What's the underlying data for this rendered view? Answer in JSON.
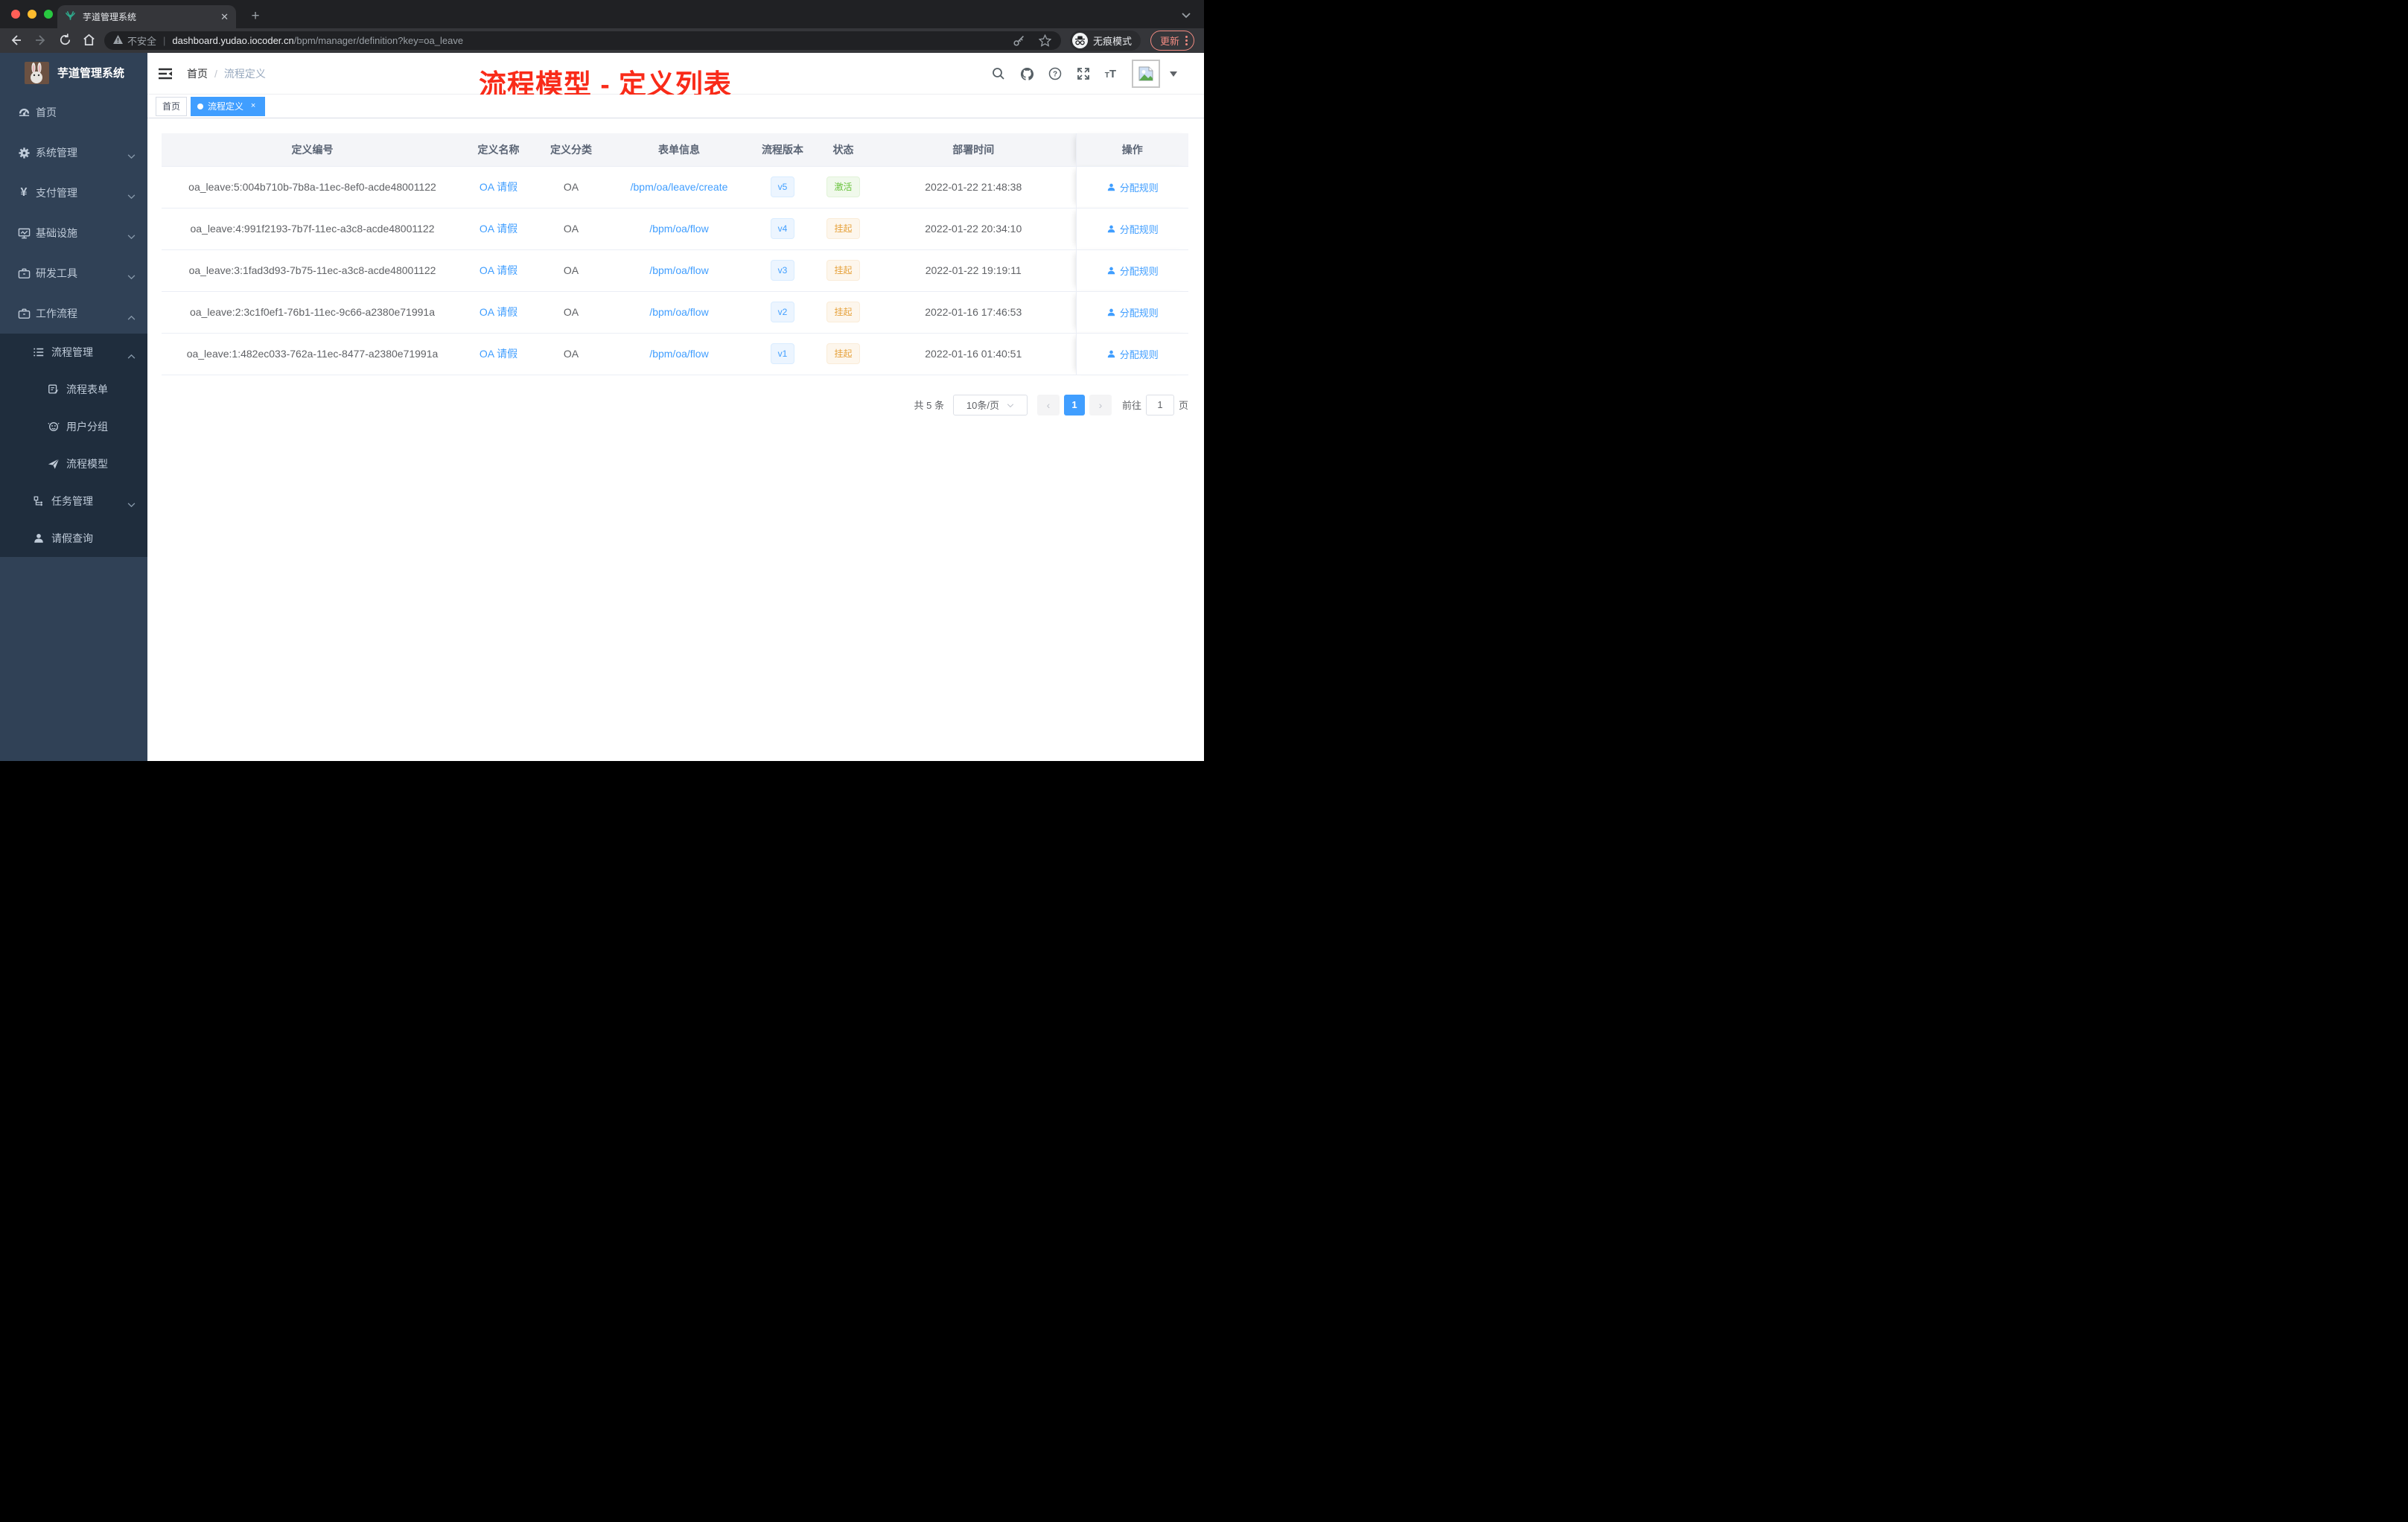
{
  "colors": {
    "accent": "#409eff",
    "success": "#67c23a",
    "warning": "#e6a23c",
    "annotation_red": "#f92b19",
    "sidebar_bg": "#304156",
    "submenu_bg": "#1f2d3d"
  },
  "browser": {
    "tab_title": "芋道管理系统",
    "new_tab_label": "+",
    "security_label": "不安全",
    "url_host": "dashboard.yudao.iocoder.cn",
    "url_path": "/bpm/manager/definition?key=oa_leave",
    "incognito_label": "无痕模式",
    "update_label": "更新"
  },
  "sidebar": {
    "brand": "芋道管理系统",
    "items": [
      {
        "label": "首页",
        "icon": "dashboard-icon"
      },
      {
        "label": "系统管理",
        "icon": "gear-icon"
      },
      {
        "label": "支付管理",
        "icon": "yen-icon"
      },
      {
        "label": "基础设施",
        "icon": "monitor-icon"
      },
      {
        "label": "研发工具",
        "icon": "toolbox-icon"
      },
      {
        "label": "工作流程",
        "icon": "workflow-icon"
      },
      {
        "label": "流程管理",
        "icon": "process-list-icon"
      },
      {
        "label": "流程表单",
        "icon": "form-icon"
      },
      {
        "label": "用户分组",
        "icon": "user-group-icon"
      },
      {
        "label": "流程模型",
        "icon": "paper-plane-icon"
      },
      {
        "label": "任务管理",
        "icon": "task-tree-icon"
      },
      {
        "label": "请假查询",
        "icon": "person-icon"
      }
    ]
  },
  "header": {
    "breadcrumb_home": "首页",
    "breadcrumb_sep": "/",
    "breadcrumb_current": "流程定义",
    "annotation": "流程模型 - 定义列表"
  },
  "tags": {
    "items": [
      {
        "label": "首页"
      },
      {
        "label": "流程定义",
        "close": "×"
      }
    ]
  },
  "table": {
    "columns": [
      "定义编号",
      "定义名称",
      "定义分类",
      "表单信息",
      "流程版本",
      "状态",
      "部署时间",
      "操作"
    ],
    "rows": [
      {
        "id": "oa_leave:5:004b710b-7b8a-11ec-8ef0-acde48001122",
        "name": "OA 请假",
        "category": "OA",
        "form": "/bpm/oa/leave/create",
        "version": "v5",
        "status": "激活",
        "status_type": "success",
        "deployed_at": "2022-01-22 21:48:38",
        "action": "分配规则"
      },
      {
        "id": "oa_leave:4:991f2193-7b7f-11ec-a3c8-acde48001122",
        "name": "OA 请假",
        "category": "OA",
        "form": "/bpm/oa/flow",
        "version": "v4",
        "status": "挂起",
        "status_type": "warning",
        "deployed_at": "2022-01-22 20:34:10",
        "action": "分配规则"
      },
      {
        "id": "oa_leave:3:1fad3d93-7b75-11ec-a3c8-acde48001122",
        "name": "OA 请假",
        "category": "OA",
        "form": "/bpm/oa/flow",
        "version": "v3",
        "status": "挂起",
        "status_type": "warning",
        "deployed_at": "2022-01-22 19:19:11",
        "action": "分配规则"
      },
      {
        "id": "oa_leave:2:3c1f0ef1-76b1-11ec-9c66-a2380e71991a",
        "name": "OA 请假",
        "category": "OA",
        "form": "/bpm/oa/flow",
        "version": "v2",
        "status": "挂起",
        "status_type": "warning",
        "deployed_at": "2022-01-16 17:46:53",
        "action": "分配规则"
      },
      {
        "id": "oa_leave:1:482ec033-762a-11ec-8477-a2380e71991a",
        "name": "OA 请假",
        "category": "OA",
        "form": "/bpm/oa/flow",
        "version": "v1",
        "status": "挂起",
        "status_type": "warning",
        "deployed_at": "2022-01-16 01:40:51",
        "action": "分配规则"
      }
    ]
  },
  "pagination": {
    "total": "共 5 条",
    "page_size": "10条/页",
    "prev": "‹",
    "page": "1",
    "next": "›",
    "goto_label": "前往",
    "goto_value": "1",
    "goto_unit": "页"
  }
}
